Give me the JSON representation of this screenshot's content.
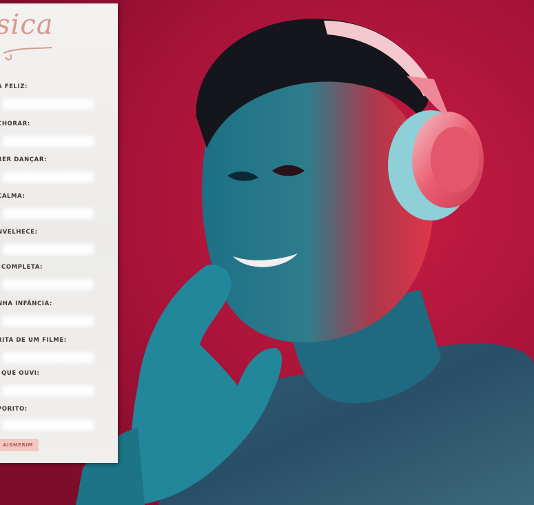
{
  "card": {
    "title": "sica",
    "prompts": [
      "A FELIZ:",
      "CHORAR:",
      "RER DANÇAR:",
      "CALMA:",
      "NVELHECE:",
      "COMPLETA:",
      "NHA INFÂNCIA:",
      "RITA DE UM FILME:",
      "QUE OUVI:",
      "PORITO:"
    ],
    "signature": "AISMERIM"
  },
  "colors": {
    "background": "#b0143a",
    "card": "#f1efed",
    "title": "#d79a8f",
    "headphones": "#e94d63"
  }
}
